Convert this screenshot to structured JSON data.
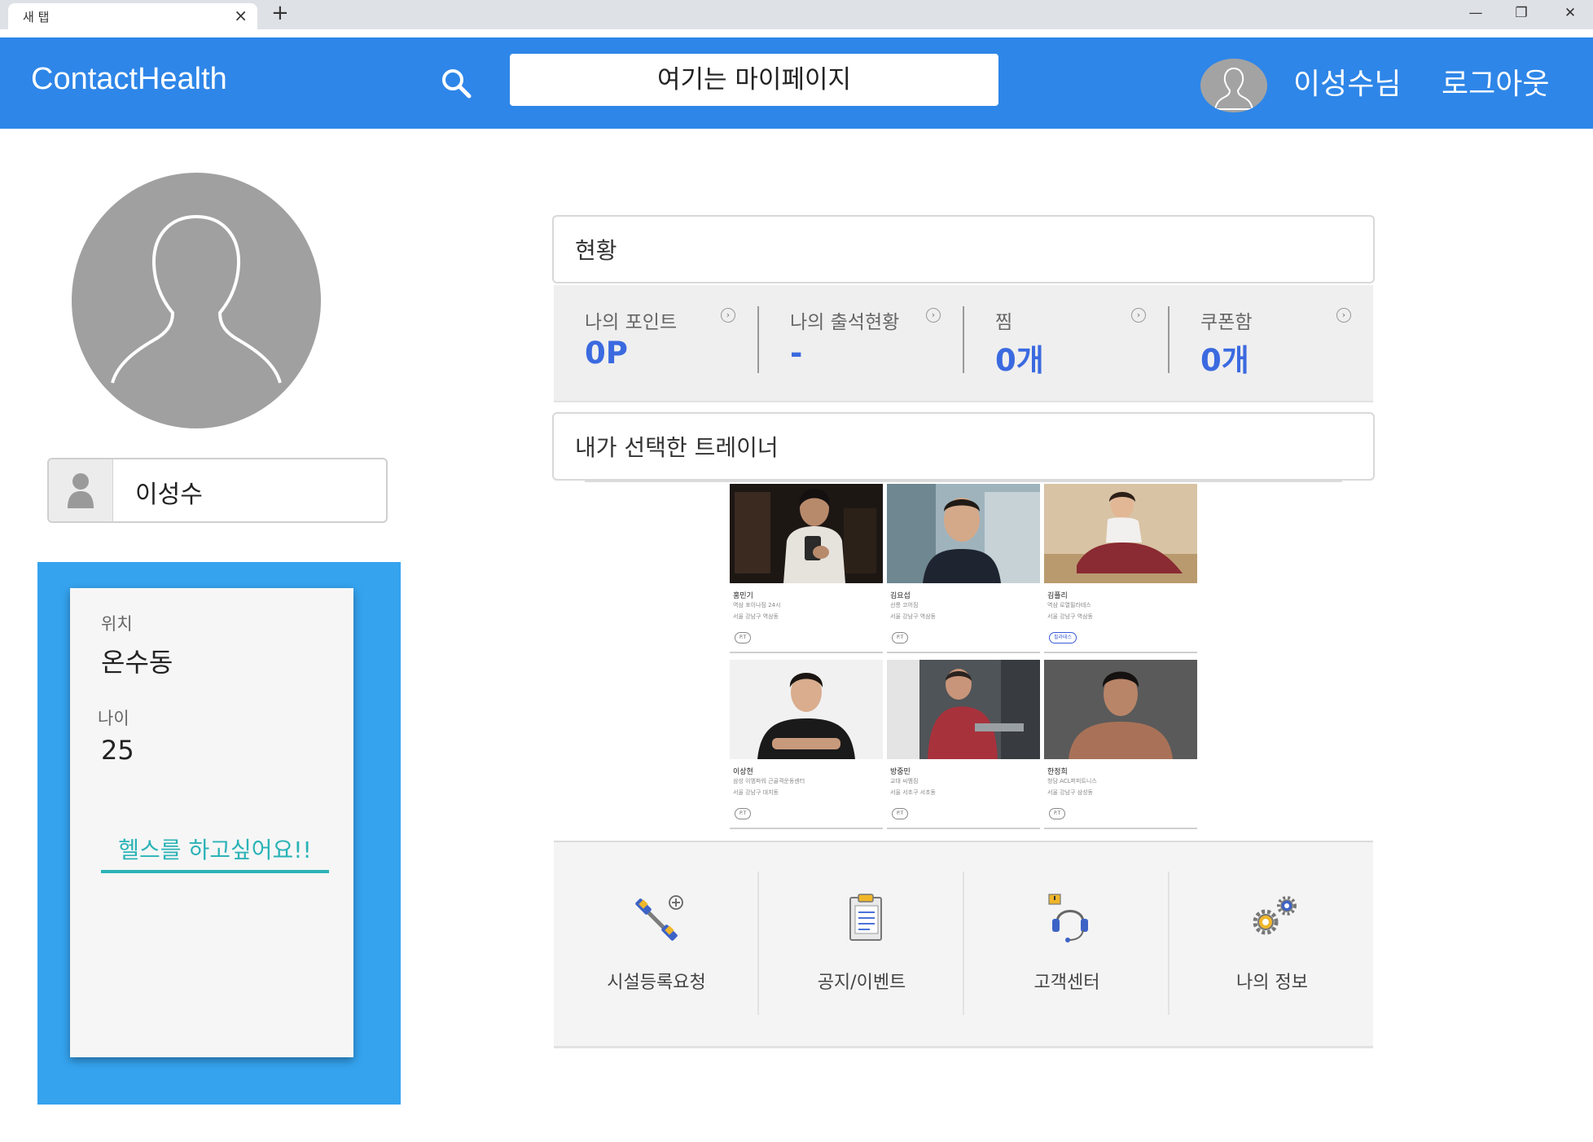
{
  "browser": {
    "tab_title": "새 탭",
    "tab_close": "×",
    "new_tab": "+",
    "window_controls": {
      "minimize": "—",
      "restore": "❐",
      "close": "✕"
    }
  },
  "header": {
    "brand": "ContactHealth",
    "search_text": "여기는 마이페이지",
    "user_name": "이성수님",
    "logout_label": "로그아웃",
    "accent_color": "#2e86e8"
  },
  "profile": {
    "name": "이성수",
    "location_label": "위치",
    "location_value": "온수동",
    "age_label": "나이",
    "age_value": "25",
    "wish": "헬스를 하고싶어요!!",
    "panel_color": "#35a3ee",
    "wish_color": "#2bb3b6"
  },
  "status": {
    "title": "현황",
    "value_color": "#3b6ae0",
    "items": [
      {
        "label": "나의 포인트",
        "value": "0P",
        "info_icon": "info-icon"
      },
      {
        "label": "나의 출석현황",
        "value": "-",
        "info_icon": "info-icon"
      },
      {
        "label": "찜",
        "value": "0개",
        "info_icon": "info-icon"
      },
      {
        "label": "쿠폰함",
        "value": "0개",
        "info_icon": "info-icon"
      }
    ]
  },
  "trainers": {
    "title": "내가 선택한 트레이너",
    "items": [
      {
        "name": "홍민기",
        "gym": "역삼 포이나짐 24시",
        "address": "서울 강남구 역삼동",
        "tag": "P.T"
      },
      {
        "name": "김요섭",
        "gym": "선릉 코어짐",
        "address": "서울 강남구 역삼동",
        "tag": "P.T"
      },
      {
        "name": "김플리",
        "gym": "역삼 로열필라테스",
        "address": "서울 강남구 역삼동",
        "tag": "필라테스"
      },
      {
        "name": "이상현",
        "gym": "삼성 이엠파워 근골격운동센터",
        "address": "서울 강남구 대치동",
        "tag": "P.T"
      },
      {
        "name": "방중민",
        "gym": "교대 씨멤짐",
        "address": "서울 서초구 서초동",
        "tag": "P.T"
      },
      {
        "name": "한정희",
        "gym": "청담 ACL퍼피트니스",
        "address": "서울 강남구 삼성동",
        "tag": "P.T"
      }
    ]
  },
  "menu": {
    "items": [
      {
        "label": "시설등록요청",
        "icon": "dumbbell-plus-icon"
      },
      {
        "label": "공지/이벤트",
        "icon": "clipboard-icon"
      },
      {
        "label": "고객센터",
        "icon": "headset-icon"
      },
      {
        "label": "나의 정보",
        "icon": "gear-icon"
      }
    ]
  }
}
